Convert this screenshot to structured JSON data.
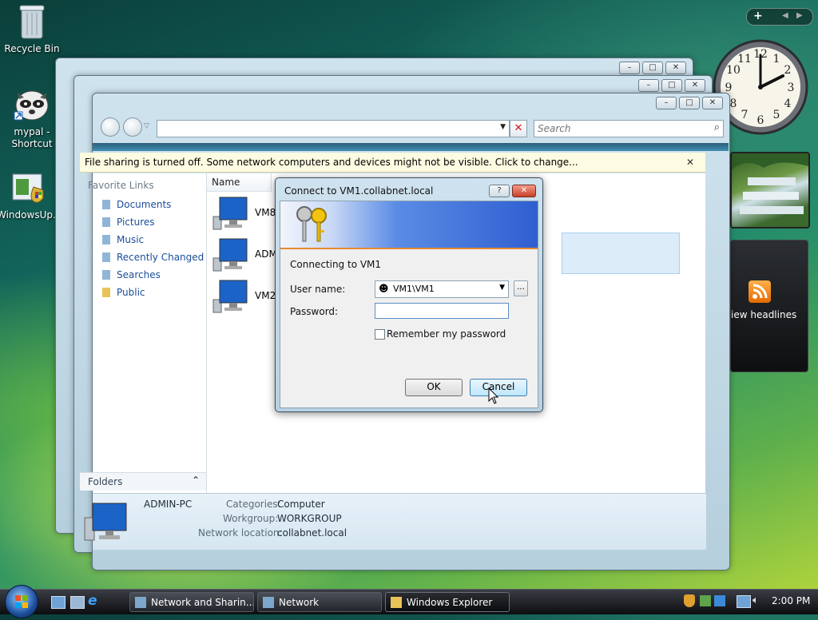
{
  "desktop": {
    "icons": [
      {
        "label": "Recycle Bin",
        "icon": "recycle-bin-icon"
      },
      {
        "label": "mypal - Shortcut",
        "icon": "raccoon-shortcut-icon"
      },
      {
        "label": "WindowsUp...",
        "icon": "windows-update-icon"
      }
    ]
  },
  "sidebar_gadgets": {
    "feed_label": "iew headlines",
    "clock": {
      "hours": 2,
      "minutes": 0
    }
  },
  "explorer": {
    "search_placeholder": "Search",
    "infobar_text": "File sharing is turned off. Some network computers and devices might not be visible. Click to change...",
    "favorite_links_header": "Favorite Links",
    "favorite_links": [
      "Documents",
      "Pictures",
      "Music",
      "Recently Changed",
      "Searches",
      "Public"
    ],
    "folders_label": "Folders",
    "column_name": "Name",
    "items": [
      "VM8",
      "ADM",
      "VM2"
    ],
    "details": {
      "name": "ADMIN-PC",
      "categories_label": "Categories:",
      "categories_value": "Computer",
      "workgroup_label": "Workgroup:",
      "workgroup_value": "WORKGROUP",
      "network_location_label": "Network location:",
      "network_location_value": "collabnet.local"
    }
  },
  "dialog": {
    "title": "Connect to VM1.collabnet.local",
    "connecting_text": "Connecting to VM1",
    "username_label": "User name:",
    "username_value": "VM1\\VM1",
    "password_label": "Password:",
    "password_value": "",
    "remember_label": "Remember my password",
    "remember_checked": false,
    "ok_label": "OK",
    "cancel_label": "Cancel",
    "help_label": "?"
  },
  "taskbar": {
    "buttons": [
      {
        "label": "Network and Sharin...",
        "icon": "network-sharing-icon"
      },
      {
        "label": "Network",
        "icon": "network-icon"
      },
      {
        "label": "Windows Explorer",
        "icon": "folder-icon"
      }
    ],
    "clock": "2:00 PM"
  },
  "colors": {
    "link": "#1b4e9a",
    "dialog_banner": "#2f5fd0",
    "taskbar": "#1a1c20"
  }
}
